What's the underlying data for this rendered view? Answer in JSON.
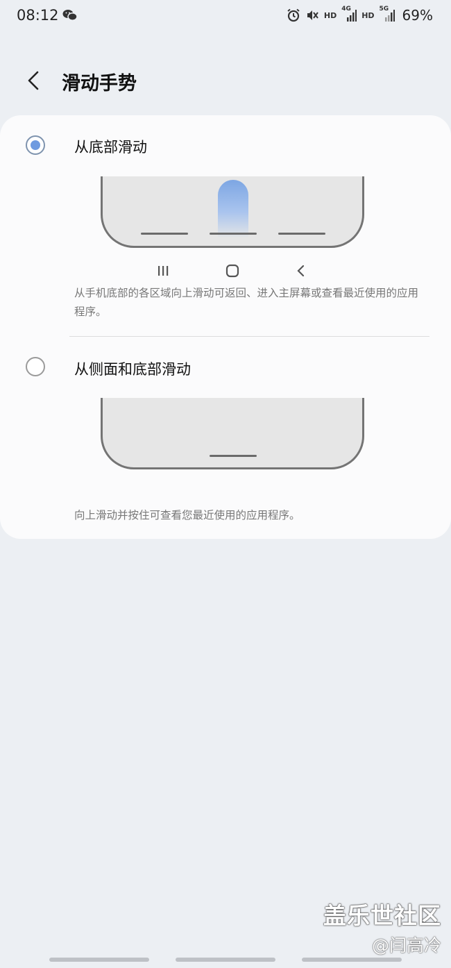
{
  "status_bar": {
    "time": "08:12",
    "hd1": "HD",
    "net1": "4G",
    "hd2": "HD",
    "net2": "5G",
    "battery": "69%"
  },
  "header": {
    "title": "滑动手势"
  },
  "options": [
    {
      "label": "从底部滑动",
      "description": "从手机底部的各区域向上滑动可返回、进入主屏幕或查看最近使用的应用程序。",
      "selected": true
    },
    {
      "label": "从侧面和底部滑动",
      "description": "向上滑动并按住可查看您最近使用的应用程序。",
      "selected": false
    }
  ],
  "watermark": {
    "line1": "盖乐世社区",
    "line2": "@闫高冷"
  },
  "colors": {
    "background": "#ECEFF3",
    "card": "#FBFBFC",
    "accent": "#6E9AE0"
  }
}
